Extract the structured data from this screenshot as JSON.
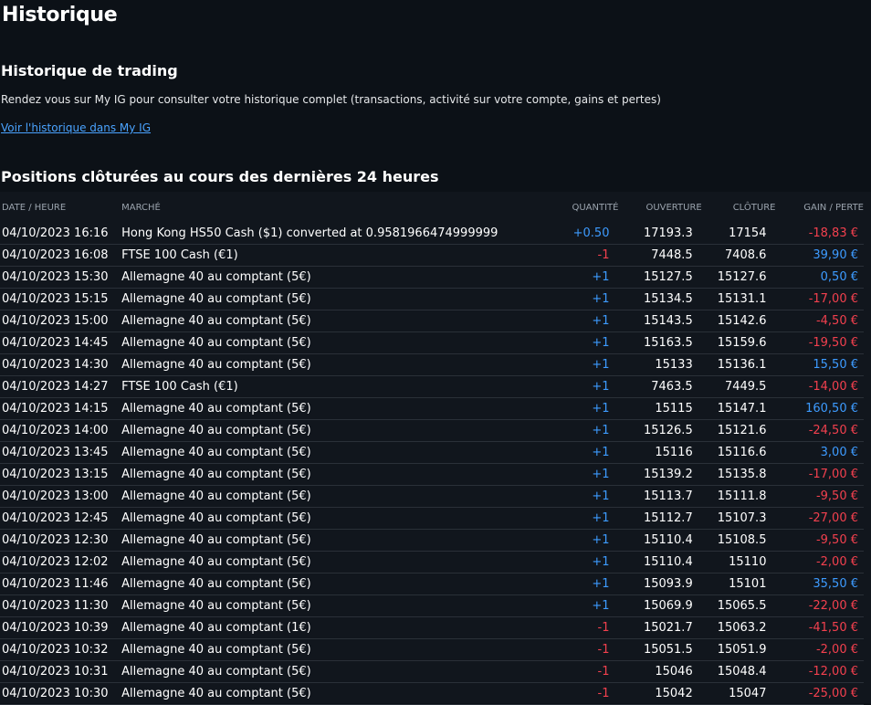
{
  "page": {
    "title": "Historique"
  },
  "trading_history": {
    "title": "Historique de trading",
    "description": "Rendez vous sur My IG pour consulter votre historique complet (transactions, activité sur votre compte, gains et pertes)",
    "link_label": "Voir l'historique dans My IG"
  },
  "positions": {
    "title": "Positions clôturées au cours des dernières 24 heures",
    "columns": [
      "DATE / HEURE",
      "MARCHÉ",
      "QUANTITÉ",
      "OUVERTURE",
      "CLÔTURE",
      "GAIN / PERTE"
    ],
    "colors": {
      "positive": "#3d9bff",
      "negative": "#f2404e"
    },
    "rows": [
      {
        "date": "04/10/2023 16:16",
        "market": "Hong Kong HS50 Cash ($1) converted at 0.9581966474999999",
        "qty": "+0.50",
        "open": "17193.3",
        "close": "17154",
        "pnl": "-18,83 €"
      },
      {
        "date": "04/10/2023 16:08",
        "market": "FTSE 100 Cash (€1)",
        "qty": "-1",
        "open": "7448.5",
        "close": "7408.6",
        "pnl": "39,90 €"
      },
      {
        "date": "04/10/2023 15:30",
        "market": "Allemagne 40 au comptant (5€)",
        "qty": "+1",
        "open": "15127.5",
        "close": "15127.6",
        "pnl": "0,50 €"
      },
      {
        "date": "04/10/2023 15:15",
        "market": "Allemagne 40 au comptant (5€)",
        "qty": "+1",
        "open": "15134.5",
        "close": "15131.1",
        "pnl": "-17,00 €"
      },
      {
        "date": "04/10/2023 15:00",
        "market": "Allemagne 40 au comptant (5€)",
        "qty": "+1",
        "open": "15143.5",
        "close": "15142.6",
        "pnl": "-4,50 €"
      },
      {
        "date": "04/10/2023 14:45",
        "market": "Allemagne 40 au comptant (5€)",
        "qty": "+1",
        "open": "15163.5",
        "close": "15159.6",
        "pnl": "-19,50 €"
      },
      {
        "date": "04/10/2023 14:30",
        "market": "Allemagne 40 au comptant (5€)",
        "qty": "+1",
        "open": "15133",
        "close": "15136.1",
        "pnl": "15,50 €"
      },
      {
        "date": "04/10/2023 14:27",
        "market": "FTSE 100 Cash (€1)",
        "qty": "+1",
        "open": "7463.5",
        "close": "7449.5",
        "pnl": "-14,00 €"
      },
      {
        "date": "04/10/2023 14:15",
        "market": "Allemagne 40 au comptant (5€)",
        "qty": "+1",
        "open": "15115",
        "close": "15147.1",
        "pnl": "160,50 €"
      },
      {
        "date": "04/10/2023 14:00",
        "market": "Allemagne 40 au comptant (5€)",
        "qty": "+1",
        "open": "15126.5",
        "close": "15121.6",
        "pnl": "-24,50 €"
      },
      {
        "date": "04/10/2023 13:45",
        "market": "Allemagne 40 au comptant (5€)",
        "qty": "+1",
        "open": "15116",
        "close": "15116.6",
        "pnl": "3,00 €"
      },
      {
        "date": "04/10/2023 13:15",
        "market": "Allemagne 40 au comptant (5€)",
        "qty": "+1",
        "open": "15139.2",
        "close": "15135.8",
        "pnl": "-17,00 €"
      },
      {
        "date": "04/10/2023 13:00",
        "market": "Allemagne 40 au comptant (5€)",
        "qty": "+1",
        "open": "15113.7",
        "close": "15111.8",
        "pnl": "-9,50 €"
      },
      {
        "date": "04/10/2023 12:45",
        "market": "Allemagne 40 au comptant (5€)",
        "qty": "+1",
        "open": "15112.7",
        "close": "15107.3",
        "pnl": "-27,00 €"
      },
      {
        "date": "04/10/2023 12:30",
        "market": "Allemagne 40 au comptant (5€)",
        "qty": "+1",
        "open": "15110.4",
        "close": "15108.5",
        "pnl": "-9,50 €"
      },
      {
        "date": "04/10/2023 12:02",
        "market": "Allemagne 40 au comptant (5€)",
        "qty": "+1",
        "open": "15110.4",
        "close": "15110",
        "pnl": "-2,00 €"
      },
      {
        "date": "04/10/2023 11:46",
        "market": "Allemagne 40 au comptant (5€)",
        "qty": "+1",
        "open": "15093.9",
        "close": "15101",
        "pnl": "35,50 €"
      },
      {
        "date": "04/10/2023 11:30",
        "market": "Allemagne 40 au comptant (5€)",
        "qty": "+1",
        "open": "15069.9",
        "close": "15065.5",
        "pnl": "-22,00 €"
      },
      {
        "date": "04/10/2023 10:39",
        "market": "Allemagne 40 au comptant (1€)",
        "qty": "-1",
        "open": "15021.7",
        "close": "15063.2",
        "pnl": "-41,50 €"
      },
      {
        "date": "04/10/2023 10:32",
        "market": "Allemagne 40 au comptant (5€)",
        "qty": "-1",
        "open": "15051.5",
        "close": "15051.9",
        "pnl": "-2,00 €"
      },
      {
        "date": "04/10/2023 10:31",
        "market": "Allemagne 40 au comptant (5€)",
        "qty": "-1",
        "open": "15046",
        "close": "15048.4",
        "pnl": "-12,00 €"
      },
      {
        "date": "04/10/2023 10:30",
        "market": "Allemagne 40 au comptant (5€)",
        "qty": "-1",
        "open": "15042",
        "close": "15047",
        "pnl": "-25,00 €"
      }
    ]
  }
}
